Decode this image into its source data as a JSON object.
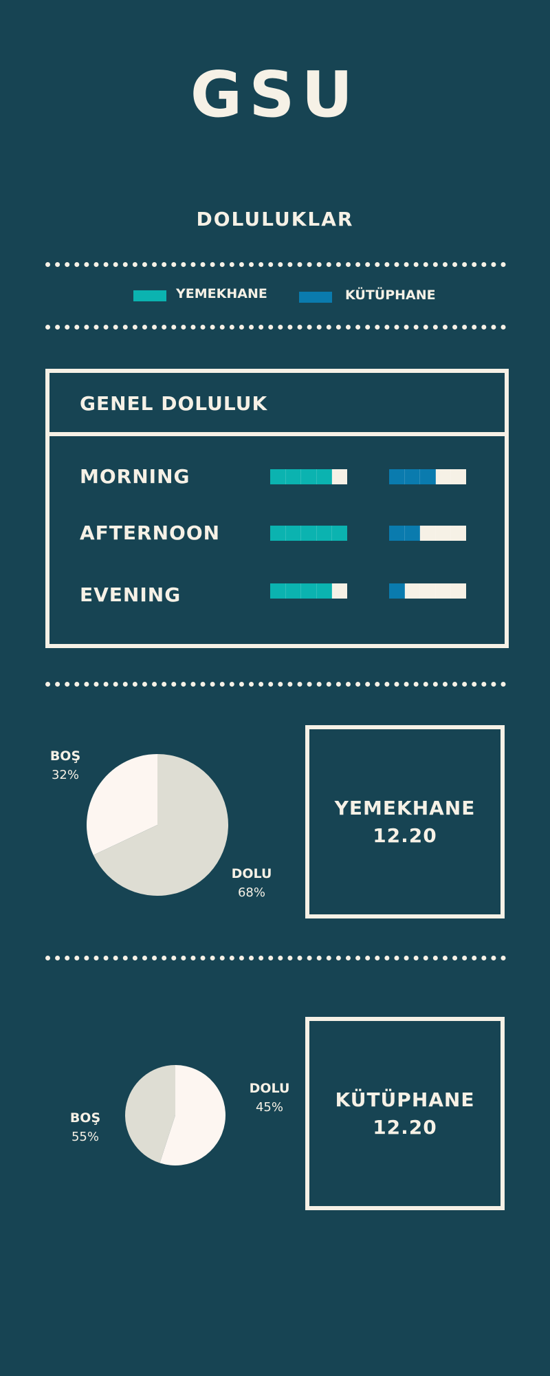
{
  "header": {
    "logo": "GSU",
    "subtitle": "DOLULUKLAR"
  },
  "legend": [
    {
      "label": "YEMEKHANE",
      "color": "#0bb3b0"
    },
    {
      "label": "KÜTÜPHANE",
      "color": "#0a7bae"
    }
  ],
  "colors": {
    "background": "#174453",
    "cream": "#f6f1e6",
    "pie_dolu": "#deddd3",
    "pie_bos": "#fdf6f1"
  },
  "occupancy_panel": {
    "title": "GENEL DOLULUK",
    "rows": [
      {
        "label": "MORNING",
        "yemekhane_filled": 4,
        "kutuphane_filled": 3
      },
      {
        "label": "AFTERNOON",
        "yemekhane_filled": 5,
        "kutuphane_filled": 2
      },
      {
        "label": "EVENING",
        "yemekhane_filled": 4,
        "kutuphane_filled": 1
      }
    ],
    "cells_per_bar": 5
  },
  "cards": [
    {
      "title": "YEMEKHANE",
      "time": "12.20"
    },
    {
      "title": "KÜTÜPHANE",
      "time": "12.20"
    }
  ],
  "chart_data": [
    {
      "type": "bar",
      "title": "GENEL DOLULUK",
      "categories": [
        "MORNING",
        "AFTERNOON",
        "EVENING"
      ],
      "series": [
        {
          "name": "YEMEKHANE",
          "values": [
            4,
            5,
            4
          ]
        },
        {
          "name": "KÜTÜPHANE",
          "values": [
            3,
            2,
            1
          ]
        }
      ],
      "ylim": [
        0,
        5
      ]
    },
    {
      "type": "pie",
      "slices": [
        {
          "label": "BOŞ",
          "value": 32,
          "value_label": "32%"
        },
        {
          "label": "DOLU",
          "value": 68,
          "value_label": "68%"
        }
      ]
    },
    {
      "type": "pie",
      "slices": [
        {
          "label": "DOLU",
          "value": 45,
          "value_label": "45%"
        },
        {
          "label": "BOŞ",
          "value": 55,
          "value_label": "55%"
        }
      ]
    }
  ]
}
